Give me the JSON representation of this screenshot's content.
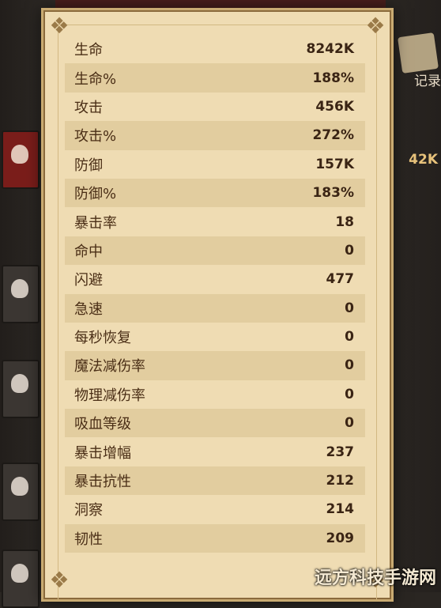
{
  "stats": [
    {
      "label": "生命",
      "value": "8242K"
    },
    {
      "label": "生命%",
      "value": "188%"
    },
    {
      "label": "攻击",
      "value": "456K"
    },
    {
      "label": "攻击%",
      "value": "272%"
    },
    {
      "label": "防御",
      "value": "157K"
    },
    {
      "label": "防御%",
      "value": "183%"
    },
    {
      "label": "暴击率",
      "value": "18"
    },
    {
      "label": "命中",
      "value": "0"
    },
    {
      "label": "闪避",
      "value": "477"
    },
    {
      "label": "急速",
      "value": "0"
    },
    {
      "label": "每秒恢复",
      "value": "0"
    },
    {
      "label": "魔法减伤率",
      "value": "0"
    },
    {
      "label": "物理减伤率",
      "value": "0"
    },
    {
      "label": "吸血等级",
      "value": "0"
    },
    {
      "label": "暴击增幅",
      "value": "237"
    },
    {
      "label": "暴击抗性",
      "value": "212"
    },
    {
      "label": "洞察",
      "value": "214"
    },
    {
      "label": "韧性",
      "value": "209"
    }
  ],
  "side": {
    "record_label": "记录",
    "partial_value": "42K"
  },
  "watermark": "远方科技手游网",
  "colors": {
    "parchment": "#efdcb3",
    "parchment_alt": "#e2cd9f",
    "label_text": "#4a2e16",
    "value_text": "#3a2414"
  }
}
